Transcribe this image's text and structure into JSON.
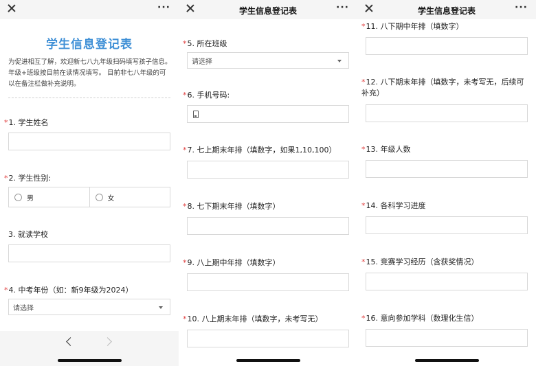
{
  "panels": [
    {
      "topbar_title": "",
      "form_title": "学生信息登记表",
      "intro": "为促进相互了解，欢迎新七八九年级扫码填写孩子信息。年级+班级按目前在读情况填写。 目前非七八年级的可以在备注栏做补充说明。",
      "q1": "1. 学生姓名",
      "q2": "2. 学生性别:",
      "q2_options": [
        "男",
        "女"
      ],
      "q3": "3. 就读学校",
      "q4": "4. 中考年份（如：新9年级为2024）",
      "q4_placeholder": "请选择"
    },
    {
      "topbar_title": "学生信息登记表",
      "q5": "5. 所在班级",
      "q5_placeholder": "请选择",
      "q6": "6. 手机号码:",
      "q7": "7. 七上期末年排（填数字，如果1,10,100）",
      "q8": "8. 七下期末年排（填数字）",
      "q9": "9. 八上期中年排（填数字）",
      "q10": "10. 八上期末年排（填数字，未考写无）"
    },
    {
      "topbar_title": "学生信息登记表",
      "q11": "11. 八下期中年排（填数字）",
      "q12": "12. 八下期末年排（填数字，未考写无，后续可补充）",
      "q13": "13. 年级人数",
      "q14": "14. 各科学习进度",
      "q15": "15. 竞赛学习经历（含获奖情况）",
      "q16": "16. 意向参加学科（数理化生信）"
    }
  ],
  "common": {
    "required_mark": "*",
    "more_label": "···"
  },
  "colors": {
    "title_blue": "#3e8fd6",
    "required_red": "#e04040",
    "bar_gray": "#f5f5f5"
  },
  "icons": [
    "close-icon",
    "more-icon",
    "chevron-down-icon",
    "phone-icon",
    "back-icon",
    "forward-icon"
  ]
}
